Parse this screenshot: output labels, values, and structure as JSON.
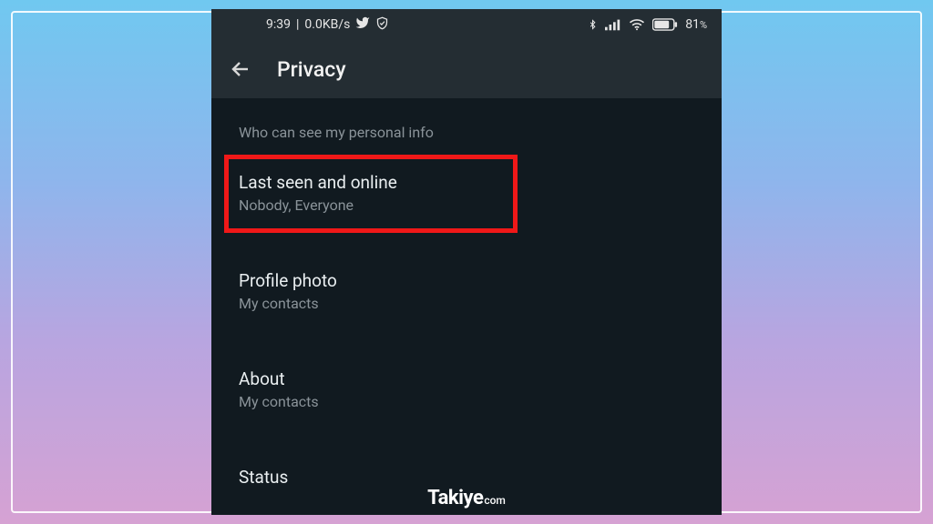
{
  "statusbar": {
    "time": "9:39",
    "sep": " | ",
    "net_speed": "0.0KB/s",
    "battery_pct": "81",
    "battery_suffix": "%"
  },
  "appbar": {
    "title": "Privacy"
  },
  "section_header": "Who can see my personal info",
  "items": {
    "last_seen": {
      "title": "Last seen and online",
      "sub": "Nobody, Everyone"
    },
    "profile_photo": {
      "title": "Profile photo",
      "sub": "My contacts"
    },
    "about": {
      "title": "About",
      "sub": "My contacts"
    },
    "status": {
      "title": "Status",
      "sub": ""
    }
  },
  "watermark": {
    "name": "Takiye",
    "suffix": "com"
  }
}
